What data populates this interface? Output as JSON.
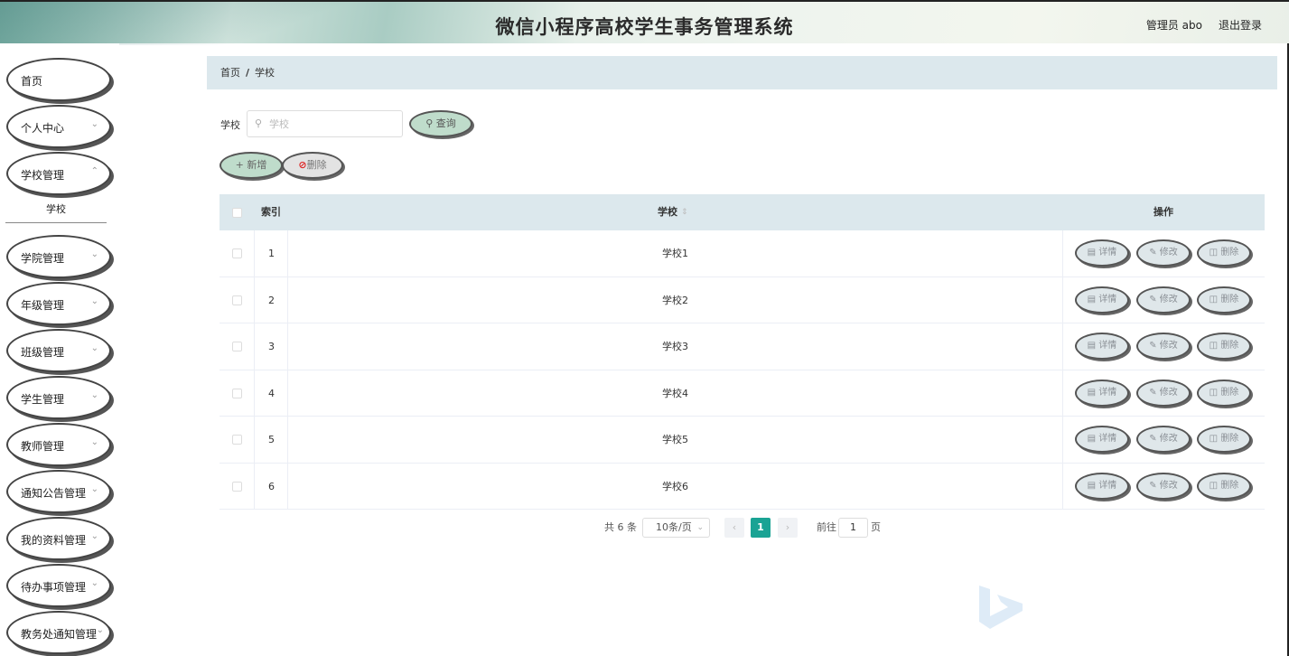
{
  "header": {
    "title": "微信小程序高校学生事务管理系统",
    "admin_label": "管理员 abo",
    "logout_label": "退出登录"
  },
  "sidebar": {
    "items": [
      {
        "label": "首页",
        "has_chevron": false
      },
      {
        "label": "个人中心",
        "has_chevron": true
      },
      {
        "label": "学校管理",
        "has_chevron": true
      },
      {
        "label": "学院管理",
        "has_chevron": true
      },
      {
        "label": "年级管理",
        "has_chevron": true
      },
      {
        "label": "班级管理",
        "has_chevron": true
      },
      {
        "label": "学生管理",
        "has_chevron": true
      },
      {
        "label": "教师管理",
        "has_chevron": true
      },
      {
        "label": "通知公告管理",
        "has_chevron": true
      },
      {
        "label": "我的资料管理",
        "has_chevron": true
      },
      {
        "label": "待办事项管理",
        "has_chevron": true
      },
      {
        "label": "教务处通知管理",
        "has_chevron": true
      }
    ],
    "submenu_label": "学校"
  },
  "breadcrumb": {
    "home": "首页",
    "separator": "/",
    "current": "学校"
  },
  "search": {
    "label": "学校",
    "placeholder": "学校",
    "value": "",
    "button": "查询"
  },
  "toolbar": {
    "add_label": "新增",
    "delete_label": "删除"
  },
  "table": {
    "headers": {
      "index": "索引",
      "school": "学校",
      "sort_icon": "sort-icon",
      "action": "操作"
    },
    "rows": [
      {
        "index": "1",
        "school": "学校1"
      },
      {
        "index": "2",
        "school": "学校2"
      },
      {
        "index": "3",
        "school": "学校3"
      },
      {
        "index": "4",
        "school": "学校4"
      },
      {
        "index": "5",
        "school": "学校5"
      },
      {
        "index": "6",
        "school": "学校6"
      }
    ],
    "row_actions": {
      "detail": "详情",
      "edit": "修改",
      "delete": "删除"
    }
  },
  "pagination": {
    "total_text": "共 6 条",
    "page_size": "10条/页",
    "current_page": "1",
    "goto_label": "前往",
    "goto_value": "1",
    "page_suffix": "页"
  },
  "colors": {
    "accent": "#1aa394",
    "header_bg": "#dce8ed",
    "button_green": "#bfdccb"
  }
}
